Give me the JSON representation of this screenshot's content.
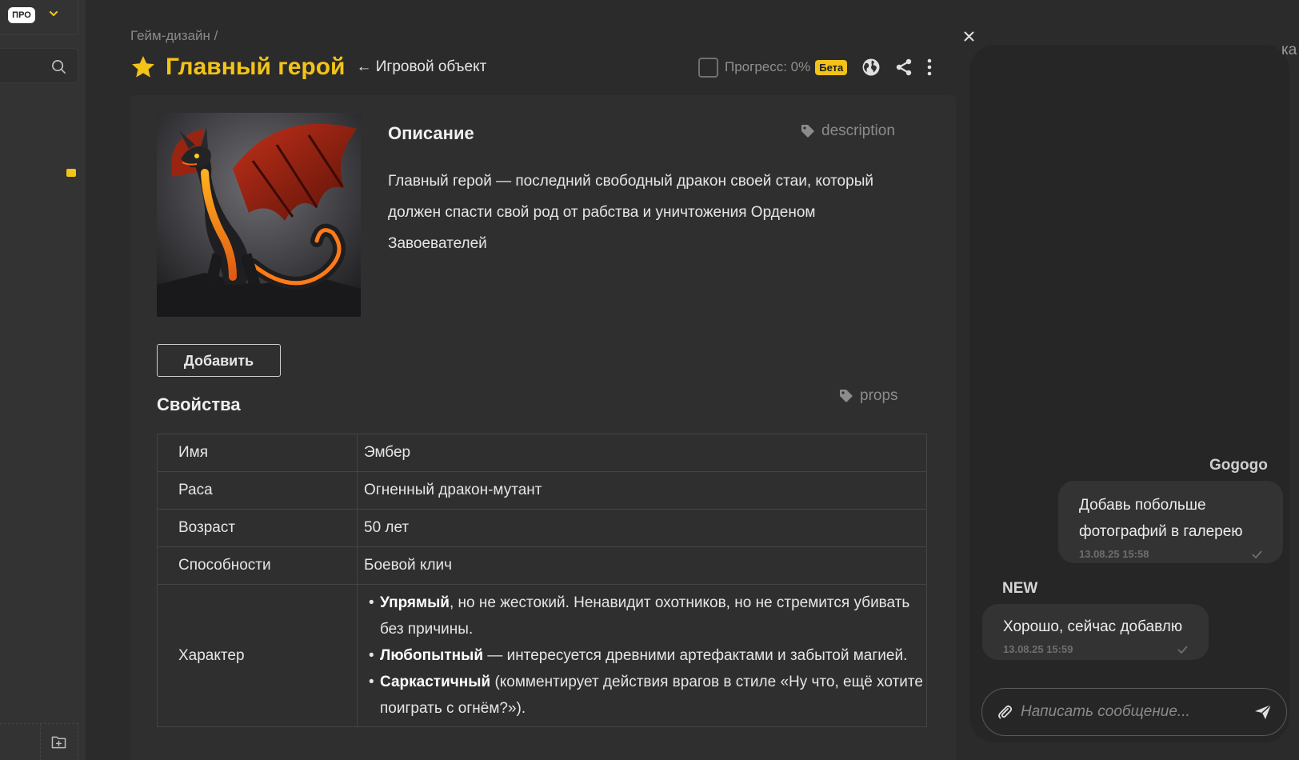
{
  "sidebar": {
    "plan_badge": "ПРО"
  },
  "header": {
    "breadcrumb": "Гейм-дизайн /",
    "title": "Главный герой",
    "type_link": "← Игровой объект",
    "progress_label": "Прогресс: 0%",
    "beta_badge": "Бета"
  },
  "description": {
    "title": "Описание",
    "tag": "description",
    "text": "Главный герой — последний свободный дракон своей стаи, который должен спасти свой род от рабства и уничтожения Орденом Завоевателей"
  },
  "add_button": "Добавить",
  "properties": {
    "title": "Свойства",
    "tag": "props",
    "rows": [
      {
        "key": "Имя",
        "value": "Эмбер"
      },
      {
        "key": "Раса",
        "value": "Огненный дракон-мутант"
      },
      {
        "key": "Возраст",
        "value": "50 лет"
      },
      {
        "key": "Способности",
        "value": "Боевой клич"
      }
    ],
    "character": {
      "key": "Характер",
      "items": [
        {
          "bold": "Упрямый",
          "rest": ", но не жестокий. Ненавидит охотников, но не стремится убивать без причины."
        },
        {
          "bold": "Любопытный",
          "rest": " — интересуется древними артефактами и забытой магией."
        },
        {
          "bold": "Саркастичный",
          "rest": " (комментирует действия врагов в стиле «Ну что, ещё хотите поиграть с огнём?»)."
        }
      ]
    }
  },
  "chat": {
    "edge_text": "ка",
    "author": "Gogogo",
    "outgoing": {
      "text": "Добавь побольше фотографий в галерею",
      "time": "13.08.25 15:58"
    },
    "new_label": "NEW",
    "incoming": {
      "text": "Хорошо, сейчас добавлю",
      "time": "13.08.25 15:59"
    },
    "compose_placeholder": "Написать сообщение..."
  },
  "colors": {
    "accent": "#f2c318",
    "background": "#2b2b2b",
    "card": "#2f2f2f",
    "chat_panel": "#262626"
  },
  "icons": [
    "chevron-down-icon",
    "search-icon",
    "comment-icon",
    "add-folder-icon",
    "star-icon",
    "globe-icon",
    "share-icon",
    "more-vertical-icon",
    "close-icon",
    "tag-icon",
    "check-icon",
    "paperclip-icon",
    "send-icon"
  ]
}
